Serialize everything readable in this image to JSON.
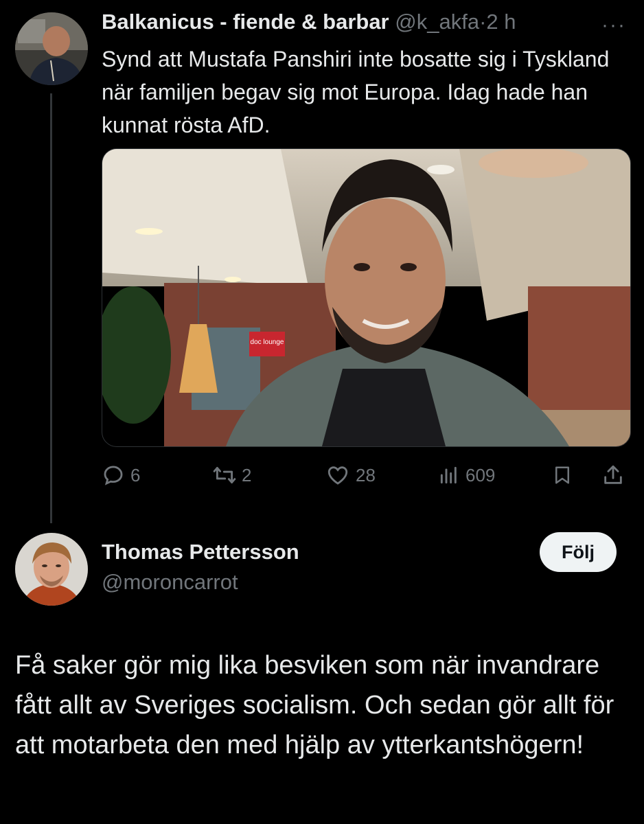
{
  "tweet1": {
    "author_name": "Balkanicus - fiende & barbar",
    "author_handle": "@k_akfa",
    "separator": "·",
    "time": "2 h",
    "more_glyph": "···",
    "text": "Synd att Mustafa Panshiri inte bosatte sig i Tyskland när familjen begav sig mot Europa. Idag hade han kunnat rösta AfD.",
    "actions": {
      "replies": "6",
      "reposts": "2",
      "likes": "28",
      "views": "609"
    },
    "photo_sign_text": "doc lounge"
  },
  "tweet2": {
    "author_name": "Thomas Pettersson",
    "author_handle": "@moroncarrot",
    "follow_label": "Följ",
    "text": "Få saker gör mig lika besviken som när invandrare fått allt av Sveriges socialism. Och sedan gör allt för att motarbeta den med hjälp av ytterkantshögern!"
  },
  "colors": {
    "background": "#000000",
    "text": "#e7e9ea",
    "muted": "#71767b",
    "follow_button_bg": "#eff3f4"
  },
  "icons": [
    "reply-icon",
    "repost-icon",
    "like-icon",
    "views-icon",
    "bookmark-icon",
    "share-icon",
    "more-icon"
  ]
}
